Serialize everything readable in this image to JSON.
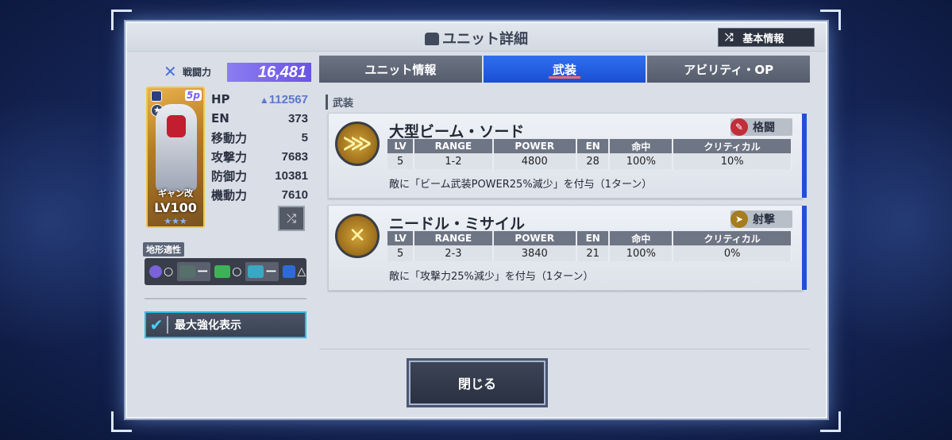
{
  "header": {
    "title": "ユニット詳細",
    "basic_info": "基本情報"
  },
  "power": {
    "label": "戦闘力",
    "value": "16,481"
  },
  "unit": {
    "name": "ギャン改",
    "level": "LV100",
    "badge": "5p",
    "stars": "★★★"
  },
  "stats": [
    {
      "label": "HP",
      "value": "112567"
    },
    {
      "label": "EN",
      "value": "373"
    },
    {
      "label": "移動力",
      "value": "5"
    },
    {
      "label": "攻撃力",
      "value": "7683"
    },
    {
      "label": "防御力",
      "value": "10381"
    },
    {
      "label": "機動力",
      "value": "7610"
    }
  ],
  "terrain": {
    "label": "地形適性",
    "items": [
      {
        "icon": "space-icon",
        "grade": "○",
        "color": "#7a63d8"
      },
      {
        "icon": "land-icon",
        "grade": "ー",
        "color": "#55706b"
      },
      {
        "icon": "ground-icon",
        "grade": "○",
        "color": "#3fb05a"
      },
      {
        "icon": "water-icon",
        "grade": "ー",
        "color": "#3aa8c2"
      },
      {
        "icon": "underwater-icon",
        "grade": "△",
        "color": "#2f6bd6"
      }
    ]
  },
  "max_button": "最大強化表示",
  "tabs": [
    "ユニット情報",
    "武装",
    "アビリティ・OP"
  ],
  "section_label": "武装",
  "table_headers": [
    "LV",
    "RANGE",
    "POWER",
    "EN",
    "命中",
    "クリティカル"
  ],
  "weapons": [
    {
      "name": "大型ビーム・ソード",
      "type": "格闘",
      "values": [
        "5",
        "1-2",
        "4800",
        "28",
        "100%",
        "10%"
      ],
      "desc": "敵に「ビーム武装POWER25%減少」を付与（1ターン）"
    },
    {
      "name": "ニードル・ミサイル",
      "type": "射撃",
      "values": [
        "5",
        "2-3",
        "3840",
        "21",
        "100%",
        "0%"
      ],
      "desc": "敵に「攻撃力25%減少」を付与（1ターン）"
    }
  ],
  "close_button": "閉じる"
}
